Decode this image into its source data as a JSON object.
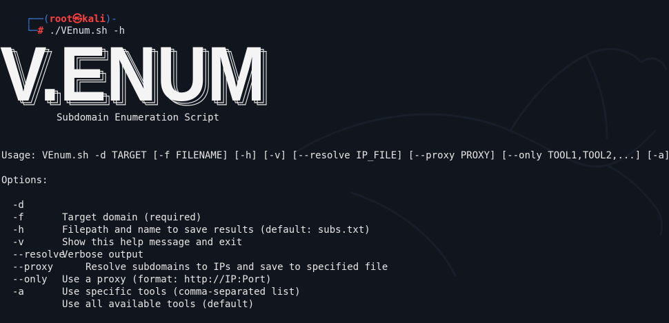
{
  "prompt": {
    "user": "root",
    "at_symbol": "㉿",
    "host": "kali",
    "hash": "#",
    "command": "./VEnum.sh -h"
  },
  "banner": {
    "logo_text": "V.ENUM",
    "subtitle": "Subdomain Enumeration Script"
  },
  "help": {
    "usage": "Usage: VEnum.sh -d TARGET [-f FILENAME] [-h] [-v] [--resolve IP_FILE] [--proxy PROXY] [--only TOOL1,TOOL2,...] [-a]",
    "options_header": "Options:",
    "options": [
      {
        "flag": "-d",
        "desc": "Target domain (required)"
      },
      {
        "flag": "-f",
        "desc": "Filepath and name to save results (default: subs.txt)"
      },
      {
        "flag": "-h",
        "desc": "Show this help message and exit"
      },
      {
        "flag": "-v",
        "desc": "Verbose output"
      },
      {
        "flag": "--resolve",
        "desc": "Resolve subdomains to IPs and save to specified file"
      },
      {
        "flag": "--proxy",
        "desc": "Use a proxy (format: http://IP:Port)"
      },
      {
        "flag": "--only",
        "desc": "Use specific tools (comma-separated list)"
      },
      {
        "flag": "-a",
        "desc": "Use all available tools (default)"
      }
    ]
  },
  "colors": {
    "background": "#11151d",
    "prompt_frame": "#3d7be0",
    "prompt_user": "#ff4040",
    "text": "#e6e6e6"
  }
}
